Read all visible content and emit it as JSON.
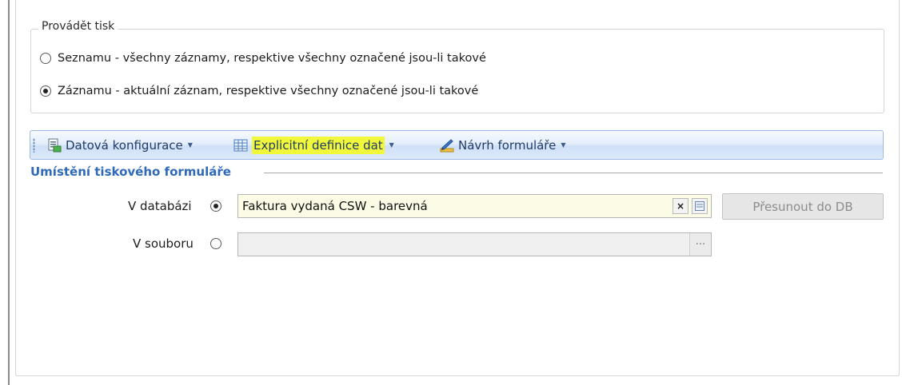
{
  "print_group": {
    "title": "Provádět tisk",
    "options": [
      {
        "label": "Seznamu - všechny záznamy, respektive všechny označené jsou-li takové",
        "checked": false
      },
      {
        "label": "Záznamu - aktuální záznam, respektive všechny označené jsou-li takové",
        "checked": true
      }
    ]
  },
  "toolbar": {
    "items": [
      {
        "label": "Datová konfigurace",
        "icon": "data-config-icon"
      },
      {
        "label": "Explicitní definice dat",
        "icon": "grid-table-icon",
        "highlighted": true,
        "highlight_color": "#f1f73a"
      },
      {
        "label": "Návrh formuláře",
        "icon": "form-design-icon"
      }
    ]
  },
  "location": {
    "title": "Umístění tiskového formuláře",
    "database": {
      "label": "V databázi",
      "value": "Faktura vydaná CSW - barevná",
      "checked": true,
      "clear_symbol": "×"
    },
    "file": {
      "label": "V souboru",
      "value": "",
      "checked": false,
      "browse_symbol": "···"
    },
    "move_button": "Přesunout do DB"
  },
  "colors": {
    "accent": "#2e6ab8",
    "highlight": "#f1f73a",
    "field_bg": "#fcfce6"
  }
}
